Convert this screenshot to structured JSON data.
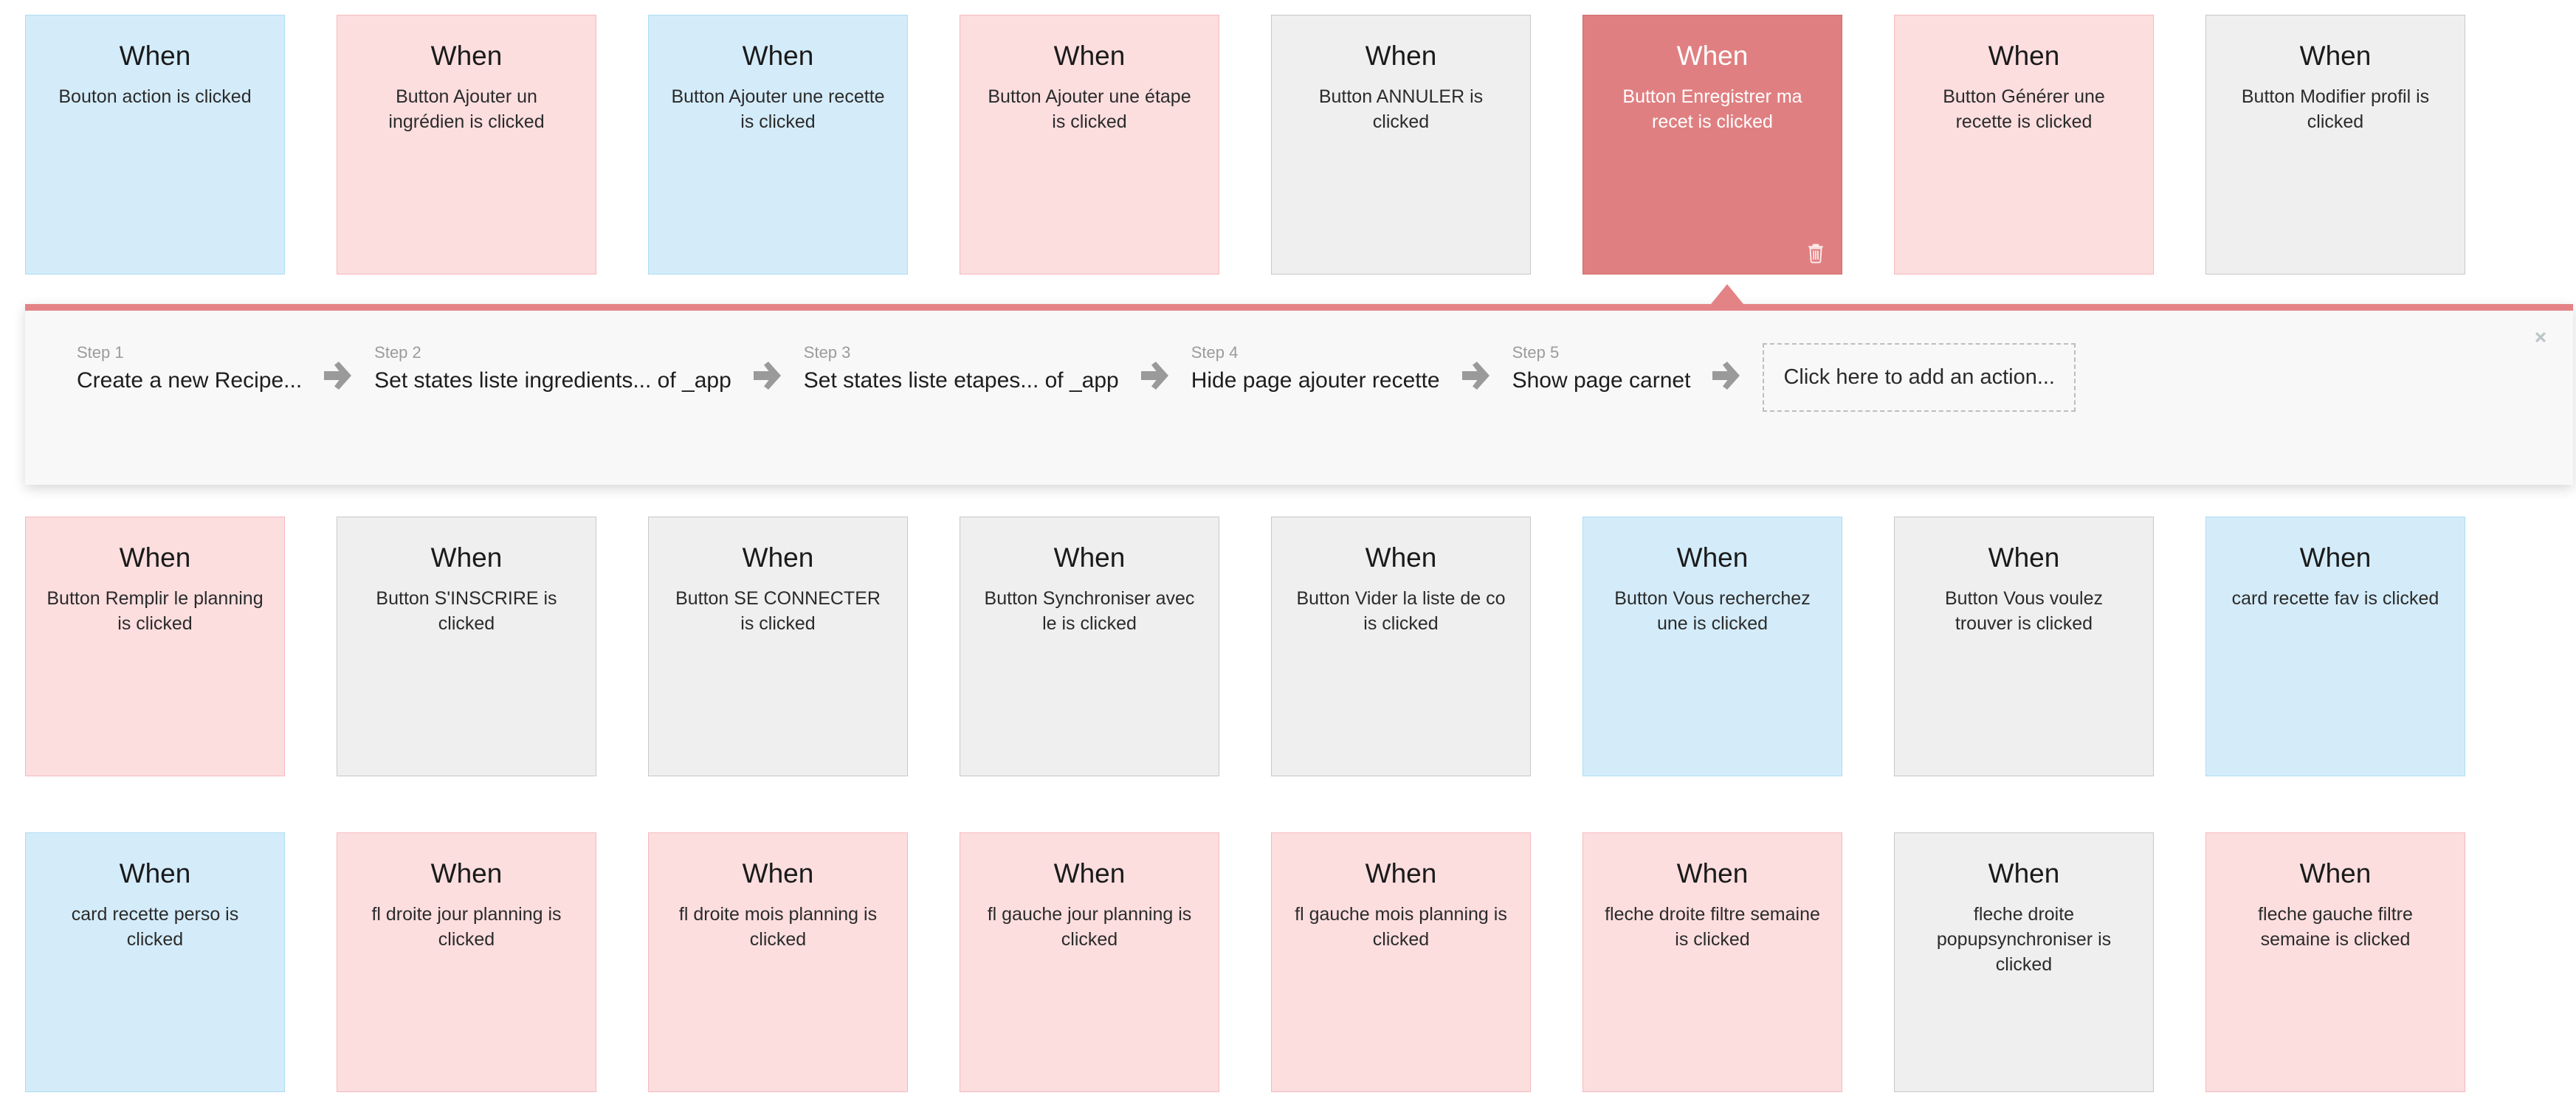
{
  "colors": {
    "blue_bg": "#d4ecfa",
    "blue_border": "#aedcf3",
    "pink_bg": "#fcdedf",
    "pink_border": "#f6b9bd",
    "grey_bg": "#efefef",
    "grey_border": "#c8c8c8",
    "selected_bg": "#e07f81",
    "panel_accent": "#e48386",
    "panel_bg": "#f8f8f8",
    "arrow_grey": "#9a9a9a",
    "step_number_grey": "#9b9b9b"
  },
  "cards": [
    {
      "when": "When",
      "desc": "Bouton action is clicked",
      "style": "blue",
      "row": 1,
      "col": 1,
      "trash": false
    },
    {
      "when": "When",
      "desc": "Button Ajouter un ingrédien is clicked",
      "style": "pink",
      "row": 1,
      "col": 2,
      "trash": false
    },
    {
      "when": "When",
      "desc": "Button Ajouter une recette is clicked",
      "style": "blue",
      "row": 1,
      "col": 3,
      "trash": false
    },
    {
      "when": "When",
      "desc": "Button Ajouter une étape is clicked",
      "style": "pink",
      "row": 1,
      "col": 4,
      "trash": false
    },
    {
      "when": "When",
      "desc": "Button ANNULER is clicked",
      "style": "grey",
      "row": 1,
      "col": 5,
      "trash": false
    },
    {
      "when": "When",
      "desc": "Button Enregistrer ma recet is clicked",
      "style": "selected",
      "row": 1,
      "col": 6,
      "trash": true
    },
    {
      "when": "When",
      "desc": "Button Générer une recette is clicked",
      "style": "pink",
      "row": 1,
      "col": 7,
      "trash": false
    },
    {
      "when": "When",
      "desc": "Button Modifier profil is clicked",
      "style": "grey",
      "row": 1,
      "col": 8,
      "trash": false
    },
    {
      "when": "When",
      "desc": "Button Remplir le planning is clicked",
      "style": "pink",
      "row": 2,
      "col": 1,
      "trash": false
    },
    {
      "when": "When",
      "desc": "Button S'INSCRIRE is clicked",
      "style": "grey",
      "row": 2,
      "col": 2,
      "trash": false
    },
    {
      "when": "When",
      "desc": "Button SE CONNECTER is clicked",
      "style": "grey",
      "row": 2,
      "col": 3,
      "trash": false
    },
    {
      "when": "When",
      "desc": "Button Synchroniser avec le is clicked",
      "style": "grey",
      "row": 2,
      "col": 4,
      "trash": false
    },
    {
      "when": "When",
      "desc": "Button Vider la liste de co is clicked",
      "style": "grey",
      "row": 2,
      "col": 5,
      "trash": false
    },
    {
      "when": "When",
      "desc": "Button Vous recherchez une is clicked",
      "style": "blue",
      "row": 2,
      "col": 6,
      "trash": false
    },
    {
      "when": "When",
      "desc": "Button Vous voulez trouver is clicked",
      "style": "grey",
      "row": 2,
      "col": 7,
      "trash": false
    },
    {
      "when": "When",
      "desc": "card recette fav is clicked",
      "style": "blue",
      "row": 2,
      "col": 8,
      "trash": false
    },
    {
      "when": "When",
      "desc": "card recette perso is clicked",
      "style": "blue",
      "row": 3,
      "col": 1,
      "trash": false
    },
    {
      "when": "When",
      "desc": "fl droite jour planning is clicked",
      "style": "pink",
      "row": 3,
      "col": 2,
      "trash": false
    },
    {
      "when": "When",
      "desc": "fl droite mois planning is clicked",
      "style": "pink",
      "row": 3,
      "col": 3,
      "trash": false
    },
    {
      "when": "When",
      "desc": "fl gauche jour planning is clicked",
      "style": "pink",
      "row": 3,
      "col": 4,
      "trash": false
    },
    {
      "when": "When",
      "desc": "fl gauche mois planning is clicked",
      "style": "pink",
      "row": 3,
      "col": 5,
      "trash": false
    },
    {
      "when": "When",
      "desc": "fleche droite filtre semaine is clicked",
      "style": "pink",
      "row": 3,
      "col": 6,
      "trash": false
    },
    {
      "when": "When",
      "desc": "fleche droite popupsynchroniser is clicked",
      "style": "grey",
      "row": 3,
      "col": 7,
      "trash": false
    },
    {
      "when": "When",
      "desc": "fleche gauche filtre semaine is clicked",
      "style": "pink",
      "row": 3,
      "col": 8,
      "trash": false
    }
  ],
  "workflow_panel": {
    "close_label": "✖",
    "steps": [
      {
        "number": "Step 1",
        "title": "Create a new Recipe..."
      },
      {
        "number": "Step 2",
        "title": "Set states liste ingredients... of _app"
      },
      {
        "number": "Step 3",
        "title": "Set states liste etapes... of _app"
      },
      {
        "number": "Step 4",
        "title": "Hide page ajouter recette"
      },
      {
        "number": "Step 5",
        "title": "Show page carnet"
      }
    ],
    "add_action_label": "Click here to add an action..."
  }
}
